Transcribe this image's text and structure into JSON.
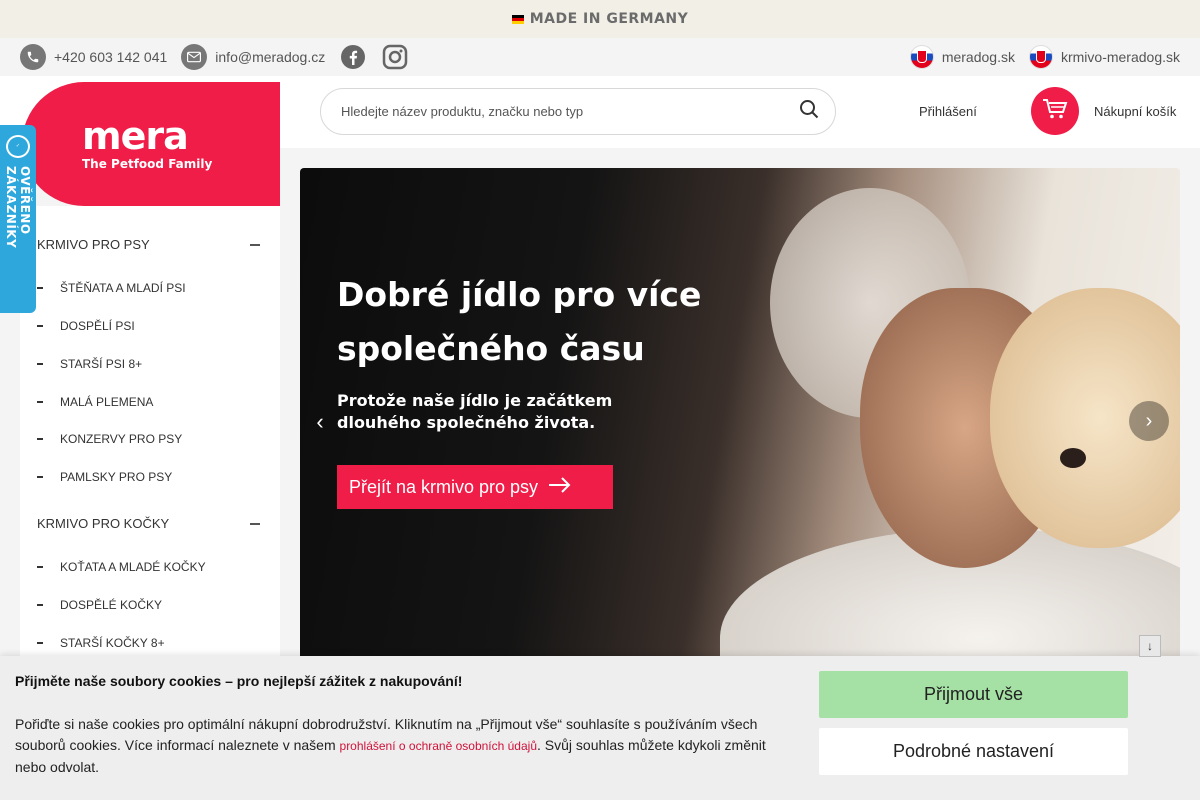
{
  "topbar": {
    "made_in": "MADE IN GERMANY"
  },
  "contact": {
    "phone": "+420 603 142 041",
    "email": "info@meradog.cz",
    "links": [
      "meradog.sk",
      "krmivo-meradog.sk"
    ]
  },
  "logo": {
    "name": "mera",
    "tagline": "The Petfood Family"
  },
  "badge": {
    "seal": "OVĚŘENO ZÁKAZNÍKY",
    "text": "OVĚŘENO ZÁKAZNÍKY"
  },
  "search": {
    "placeholder": "Hledejte název produktu, značku nebo typ"
  },
  "header": {
    "login": "Přihlášení",
    "cart": "Nákupní košík"
  },
  "sidebar": {
    "dogs": {
      "label": "KRMIVO PRO PSY",
      "items": [
        "ŠTĚŇATA A MLADÍ PSI",
        "DOSPĚLÍ PSI",
        "STARŠÍ PSI 8+",
        "MALÁ PLEMENA",
        "KONZERVY PRO PSY",
        "PAMLSKY PRO PSY"
      ]
    },
    "cats": {
      "label": "KRMIVO PRO KOČKY",
      "items": [
        "KOŤATA A MLADÉ KOČKY",
        "DOSPĚLÉ KOČKY",
        "STARŠÍ KOČKY 8+"
      ]
    }
  },
  "banner": {
    "headline": "Dobré jídlo pro více společného času",
    "sub": "Protože naše jídlo je začátkem dlouhého společného života.",
    "button": "Přejít na krmivo pro psy"
  },
  "cookie": {
    "title": "Přijměte naše soubory cookies – pro nejlepší zážitek z nakupování!",
    "text_before": "Pořiďte si naše cookies pro optimální nákupní dobrodružství. Kliknutím na „Přijmout vše“ souhlasíte s používáním všech souborů cookies. Více informací naleznete v našem ",
    "link": "prohlášení o ochraně osobních údajů",
    "text_after": ". Svůj souhlas můžete kdykoli změnit nebo odvolat.",
    "accept": "Přijmout vše",
    "settings": "Podrobné nastavení"
  },
  "colors": {
    "brand_red": "#ef1d48",
    "accept_green": "#a5e1a4",
    "badge_blue": "#2ea8dc"
  }
}
